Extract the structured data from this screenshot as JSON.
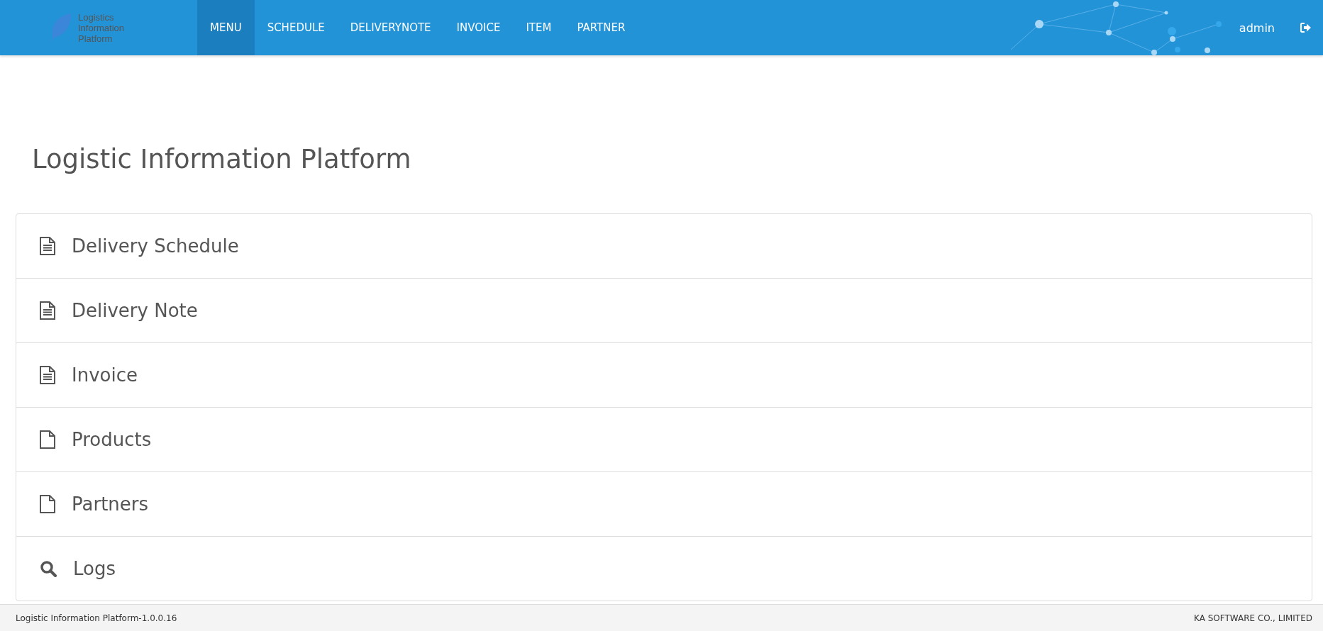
{
  "header": {
    "logo_lines": [
      "Logistics",
      "Information",
      "Platform"
    ],
    "nav": [
      {
        "label": "MENU",
        "selected": true
      },
      {
        "label": "SCHEDULE",
        "selected": false
      },
      {
        "label": "DELIVERYNOTE",
        "selected": false
      },
      {
        "label": "INVOICE",
        "selected": false
      },
      {
        "label": "ITEM",
        "selected": false
      },
      {
        "label": "PARTNER",
        "selected": false
      }
    ],
    "user": "admin"
  },
  "page_title": "Logistic Information Platform",
  "menu_items": [
    {
      "label": "Delivery Schedule",
      "kind": "document"
    },
    {
      "label": "Delivery Note",
      "kind": "document"
    },
    {
      "label": "Invoice",
      "kind": "document"
    },
    {
      "label": "Products",
      "kind": "blank"
    },
    {
      "label": "Partners",
      "kind": "blank"
    },
    {
      "label": "Logs",
      "kind": "search"
    }
  ],
  "footer": {
    "left": "Logistic Information Platform-1.0.0.16",
    "right": "KA SOFTWARE CO., LIMITED"
  }
}
